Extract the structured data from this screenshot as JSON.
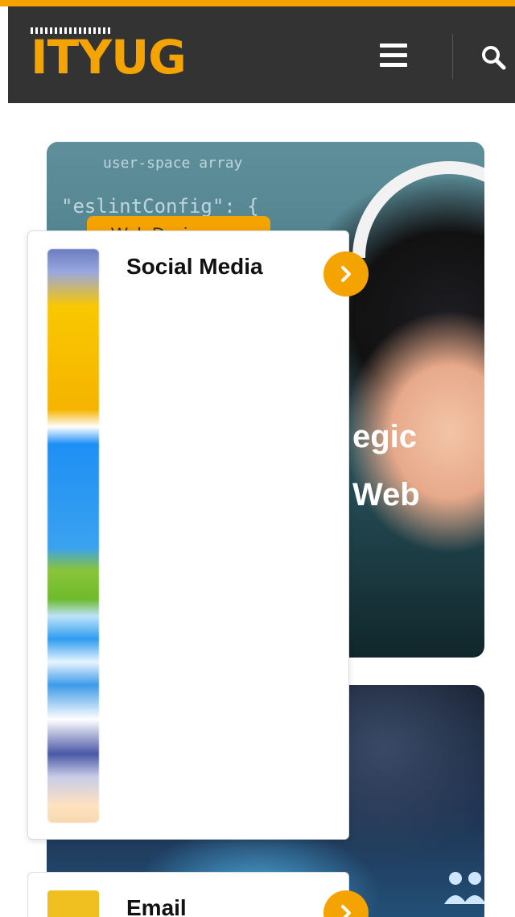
{
  "brand": {
    "logo_text": "ITYUG"
  },
  "header": {
    "menu_icon": "hamburger-menu-icon",
    "search_icon": "search-icon"
  },
  "hero": {
    "code_lines": [
      "user-space array",
      "\"eslintConfig\": {"
    ],
    "badge": "Web Design",
    "title_fragments": [
      "egic",
      "Web"
    ]
  },
  "dropdown": {
    "items": [
      {
        "title": "Social Media",
        "icon": "chevron-right-icon"
      },
      {
        "title": "Email",
        "icon": "chevron-right-icon"
      }
    ]
  },
  "colors": {
    "accent": "#f5a300",
    "header_bg": "#333333"
  }
}
